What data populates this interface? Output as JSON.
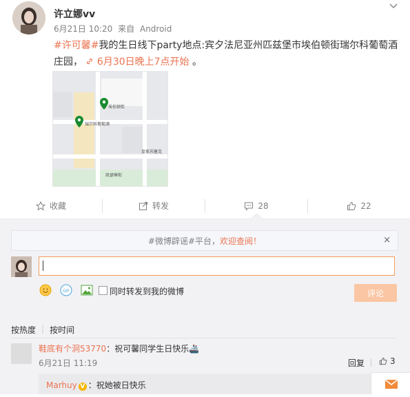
{
  "post": {
    "username": "许立娜vv",
    "date": "6月21日 10:20",
    "source_prefix": "来自",
    "source": "Android",
    "hashtag": "#许可馨#",
    "text": "我的生日线下party地点:宾夕法尼亚州匹兹堡市埃伯顿街瑞尔科葡萄酒庄园，",
    "event_link": "6月30日晚上7点开始",
    "text_end": "。",
    "map_labels": {
      "place1": "埃伯顿街",
      "place2": "瑞尔科葡萄酒",
      "place3": "皇家苏塞克",
      "place4": "凯瑟琳街"
    }
  },
  "actions": {
    "favorite": "收藏",
    "repost": "转发",
    "comment_count": "28",
    "like_count": "22"
  },
  "notice": {
    "prefix": "#微博辟谣#平台，",
    "highlight": "欢迎查阅！",
    "close": "×"
  },
  "composer": {
    "sync_label": "同时转发到我的微博",
    "submit_label": "评论"
  },
  "sort": {
    "by_hot": "按热度",
    "by_time": "按时间"
  },
  "comment": {
    "user": "鞋底有个洞53770",
    "text": "：祝可馨同学生日快乐🚢",
    "time": "6月21日 11:19",
    "reply": "回复",
    "likes": "3"
  },
  "sub_comment": {
    "user": "Marhuy",
    "text": "：祝她被日快乐"
  },
  "colors": {
    "accent": "#eb7350",
    "submit_disabled": "#fbc6a3"
  }
}
